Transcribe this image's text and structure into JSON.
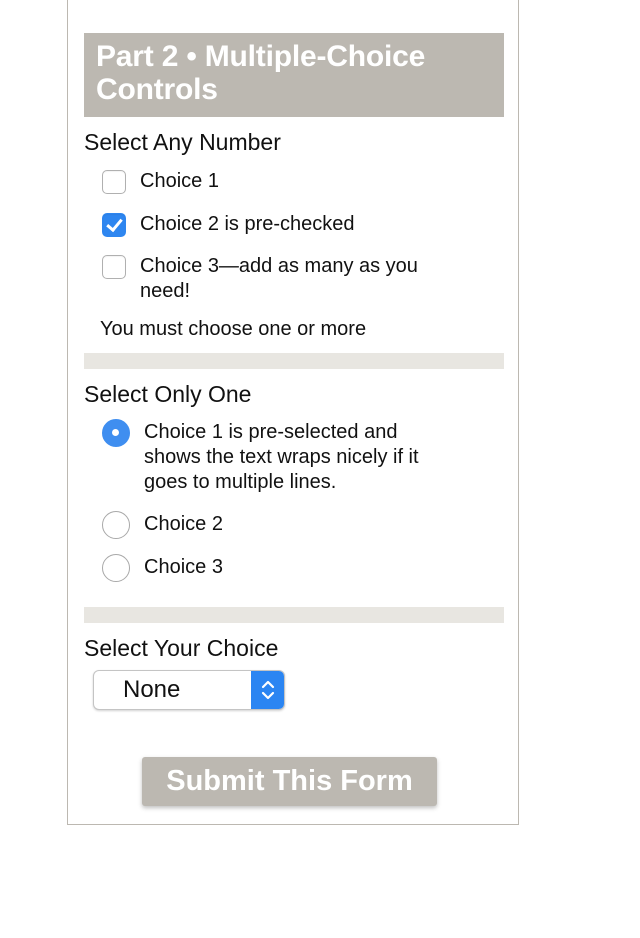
{
  "part_header": {
    "title": "Part 2 • Multiple-Choice Controls"
  },
  "checkbox_group": {
    "legend": "Select Any Number",
    "options": [
      {
        "label": "Choice 1",
        "checked": false
      },
      {
        "label": "Choice 2 is pre-checked",
        "checked": true
      },
      {
        "label": "Choice 3—add as many as you need!",
        "checked": false
      }
    ],
    "help_text": "You must choose one or more"
  },
  "radio_group": {
    "legend": "Select Only One",
    "options": [
      {
        "label": "Choice 1 is pre-selected and shows the text wraps nicely if it goes to multiple lines.",
        "selected": true
      },
      {
        "label": "Choice 2",
        "selected": false
      },
      {
        "label": "Choice 3",
        "selected": false
      }
    ]
  },
  "select_group": {
    "legend": "Select Your Choice",
    "value": "None"
  },
  "submit": {
    "label": "Submit This Form"
  },
  "colors": {
    "accent_blue": "#2e86f0",
    "header_gray": "#bcb8b1",
    "divider_gray": "#e8e6e1"
  },
  "icons": {
    "select_arrows": "chevron-up-down-icon",
    "check": "checkmark-icon"
  }
}
